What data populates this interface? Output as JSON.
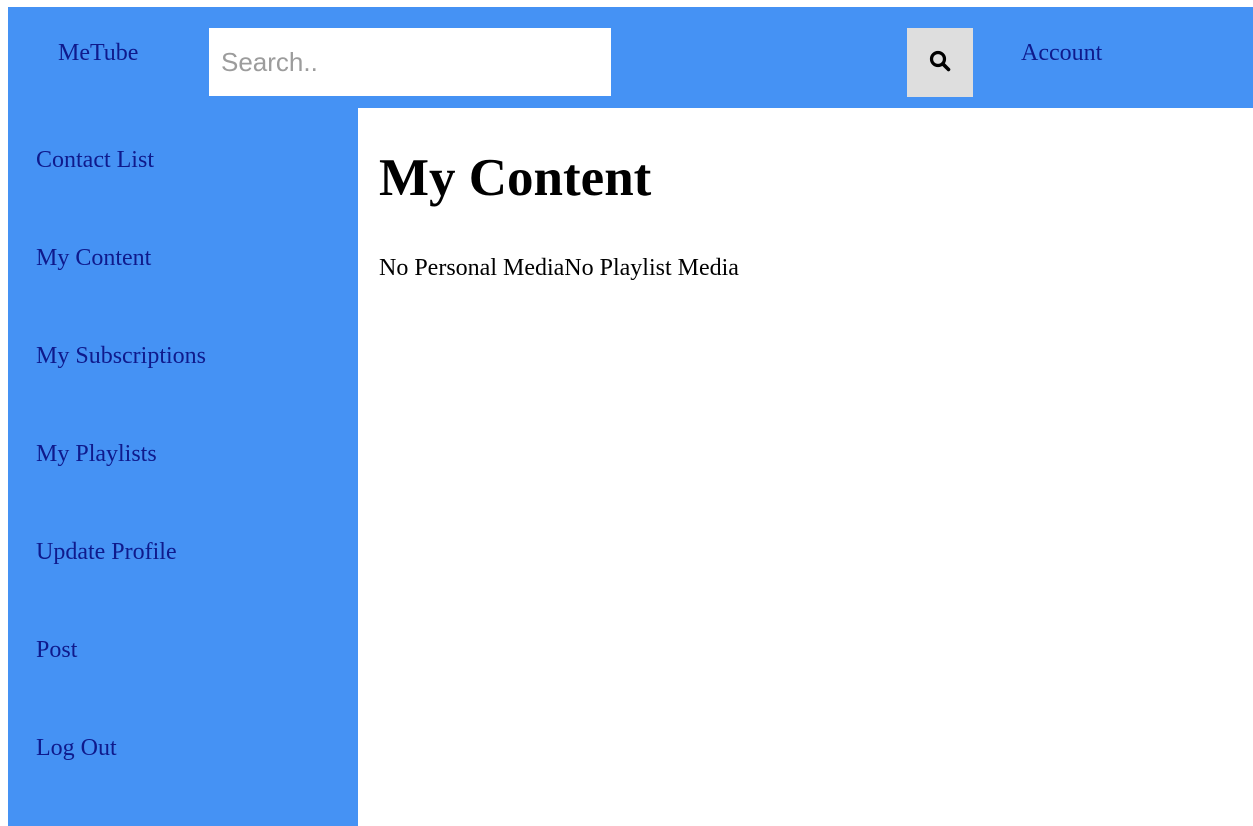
{
  "header": {
    "brand": "MeTube",
    "search_placeholder": "Search..",
    "search_value": "",
    "search_icon": "search-icon",
    "account": "Account"
  },
  "sidebar": {
    "items": [
      {
        "label": "Contact List"
      },
      {
        "label": "My Content"
      },
      {
        "label": "My Subscriptions"
      },
      {
        "label": "My Playlists"
      },
      {
        "label": "Update Profile"
      },
      {
        "label": "Post"
      },
      {
        "label": "Log Out"
      }
    ]
  },
  "main": {
    "title": "My Content",
    "personal_media_text": "No Personal Media",
    "playlist_media_text": "No Playlist Media"
  },
  "colors": {
    "nav_background": "#4592f4",
    "link_color": "#0f1a8c",
    "search_button_background": "#dedede",
    "content_background": "#ffffff"
  }
}
